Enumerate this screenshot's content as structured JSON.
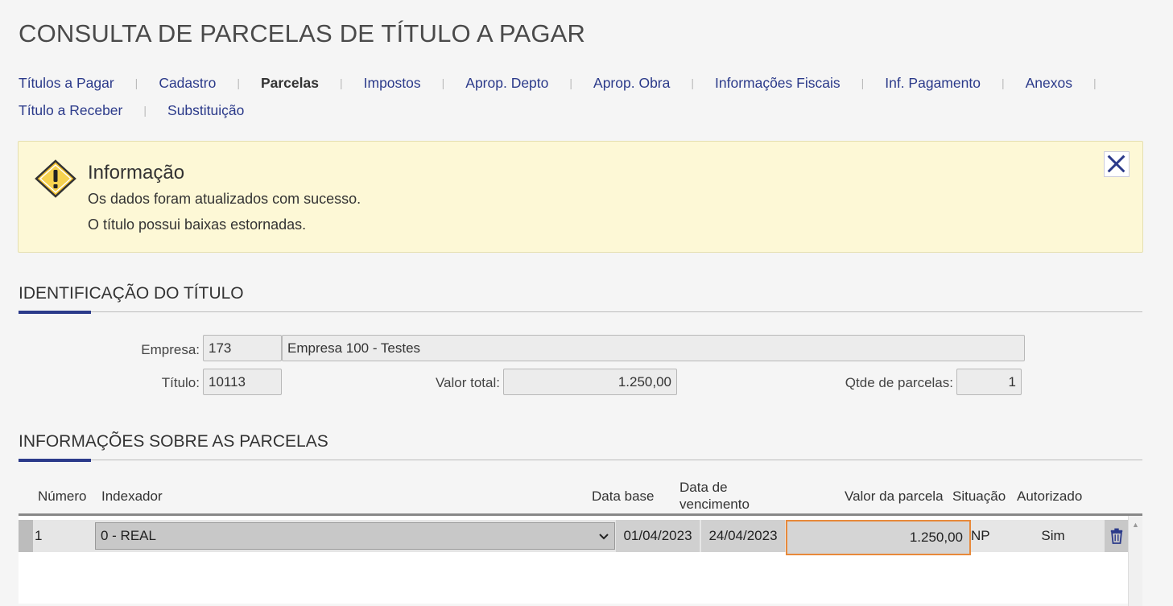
{
  "page_title": "CONSULTA DE PARCELAS DE TÍTULO A PAGAR",
  "nav": {
    "row1": [
      "Títulos a Pagar",
      "Cadastro",
      "Parcelas",
      "Impostos",
      "Aprop. Depto",
      "Aprop. Obra",
      "Informações Fiscais",
      "Inf. Pagamento",
      "Anexos"
    ],
    "row2": [
      "Título a Receber",
      "Substituição"
    ],
    "active": "Parcelas",
    "separator": "|"
  },
  "alert": {
    "title": "Informação",
    "messages": [
      "Os dados foram atualizados com sucesso.",
      "O título possui baixas estornadas."
    ],
    "icon": "warning-icon",
    "close_icon": "close-icon"
  },
  "identificacao": {
    "heading": "IDENTIFICAÇÃO DO TÍTULO",
    "empresa_label": "Empresa:",
    "empresa_code": "173",
    "empresa_name": "Empresa 100 - Testes",
    "titulo_label": "Título:",
    "titulo_value": "10113",
    "valor_total_label": "Valor total:",
    "valor_total_value": "1.250,00",
    "qtde_label": "Qtde de parcelas:",
    "qtde_value": "1"
  },
  "parcelas": {
    "heading": "INFORMAÇÕES SOBRE AS PARCELAS",
    "columns": {
      "numero": "Número",
      "indexador": "Indexador",
      "data_base": "Data base",
      "data_venc": "Data de vencimento",
      "valor": "Valor da parcela",
      "situacao": "Situação",
      "autorizado": "Autorizado"
    },
    "rows": [
      {
        "numero": "1",
        "indexador": "0 - REAL",
        "data_base": "01/04/2023",
        "data_venc": "24/04/2023",
        "valor": "1.250,00",
        "situacao": "NP",
        "autorizado": "Sim"
      }
    ]
  },
  "colors": {
    "accent": "#2b3a8a",
    "alert_bg": "#fdf8d6",
    "focus_border": "#e8893a"
  }
}
